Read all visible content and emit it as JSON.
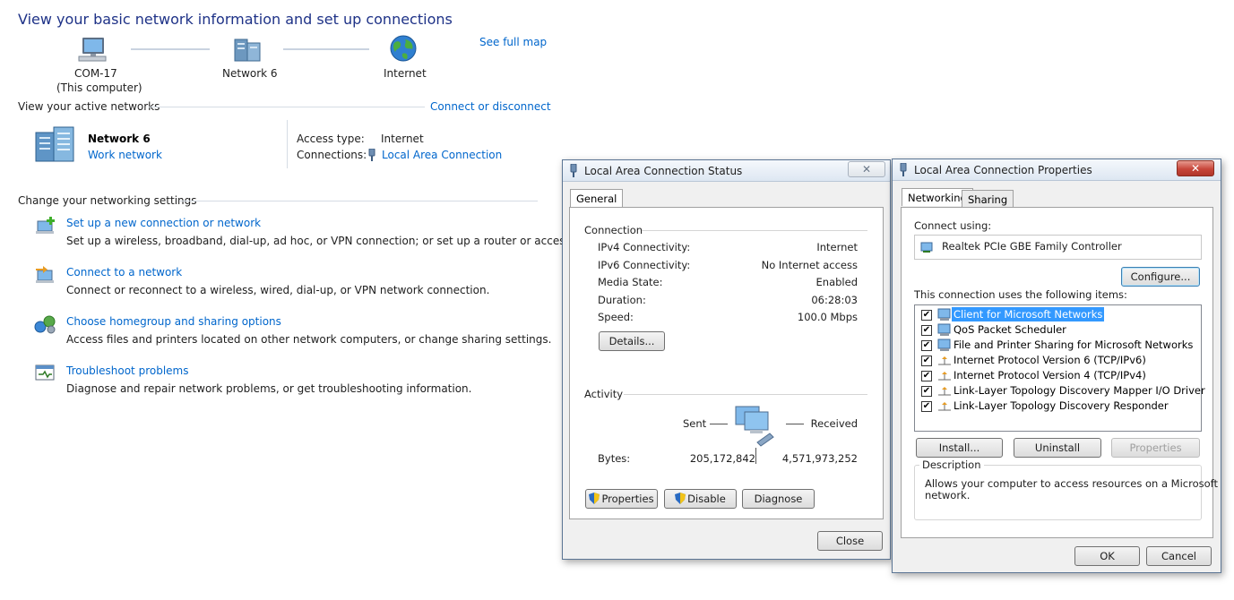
{
  "nsc": {
    "title": "View your basic network information and set up connections",
    "see_full_map": "See full map",
    "map": {
      "computer_name": "COM-17",
      "computer_sub": "(This computer)",
      "network": "Network  6",
      "internet": "Internet"
    },
    "active_networks_header": "View your active networks",
    "connect_or_disconnect": "Connect or disconnect",
    "active_network": {
      "name": "Network  6",
      "type_link": "Work network",
      "access_type_label": "Access type:",
      "access_type_value": "Internet",
      "connections_label": "Connections:",
      "connections_value": "Local Area Connection"
    },
    "change_settings_header": "Change your networking settings",
    "tasks": [
      {
        "icon": "new-connection-icon",
        "link": "Set up a new connection or network",
        "desc": "Set up a wireless, broadband, dial-up, ad hoc, or VPN connection; or set up a router or access point."
      },
      {
        "icon": "connect-network-icon",
        "link": "Connect to a network",
        "desc": "Connect or reconnect to a wireless, wired, dial-up, or VPN network connection."
      },
      {
        "icon": "homegroup-icon",
        "link": "Choose homegroup and sharing options",
        "desc": "Access files and printers located on other network computers, or change sharing settings."
      },
      {
        "icon": "troubleshoot-icon",
        "link": "Troubleshoot problems",
        "desc": "Diagnose and repair network problems, or get troubleshooting information."
      }
    ]
  },
  "status_dialog": {
    "title": "Local Area Connection Status",
    "tab_general": "General",
    "connection_group": "Connection",
    "rows": [
      {
        "label": "IPv4 Connectivity:",
        "value": "Internet"
      },
      {
        "label": "IPv6 Connectivity:",
        "value": "No Internet access"
      },
      {
        "label": "Media State:",
        "value": "Enabled"
      },
      {
        "label": "Duration:",
        "value": "06:28:03"
      },
      {
        "label": "Speed:",
        "value": "100.0 Mbps"
      }
    ],
    "details_button": "Details...",
    "activity_group": "Activity",
    "sent_label": "Sent",
    "received_label": "Received",
    "bytes_label": "Bytes:",
    "bytes_sent": "205,172,842",
    "bytes_received": "4,571,973,252",
    "properties_button": "Properties",
    "disable_button": "Disable",
    "diagnose_button": "Diagnose",
    "close_button": "Close"
  },
  "props_dialog": {
    "title": "Local Area Connection Properties",
    "tab_networking": "Networking",
    "tab_sharing": "Sharing",
    "connect_using_label": "Connect using:",
    "adapter": "Realtek PCIe GBE Family Controller",
    "configure_button": "Configure...",
    "items_label": "This connection uses the following items:",
    "items": [
      {
        "label": "Client for Microsoft Networks",
        "checked": true,
        "selected": true
      },
      {
        "label": "QoS Packet Scheduler",
        "checked": true
      },
      {
        "label": "File and Printer Sharing for Microsoft Networks",
        "checked": true
      },
      {
        "label": "Internet Protocol Version 6 (TCP/IPv6)",
        "checked": true
      },
      {
        "label": "Internet Protocol Version 4 (TCP/IPv4)",
        "checked": true
      },
      {
        "label": "Link-Layer Topology Discovery Mapper I/O Driver",
        "checked": true
      },
      {
        "label": "Link-Layer Topology Discovery Responder",
        "checked": true
      }
    ],
    "install_button": "Install...",
    "uninstall_button": "Uninstall",
    "properties_button": "Properties",
    "description_group": "Description",
    "description_line1": "Allows your computer to access resources on a Microsoft",
    "description_line2": "network.",
    "ok_button": "OK",
    "cancel_button": "Cancel"
  },
  "colors": {
    "link": "#0066cc",
    "title": "#1e3287",
    "close_red": "#c7463a",
    "selection": "#3399ff"
  }
}
